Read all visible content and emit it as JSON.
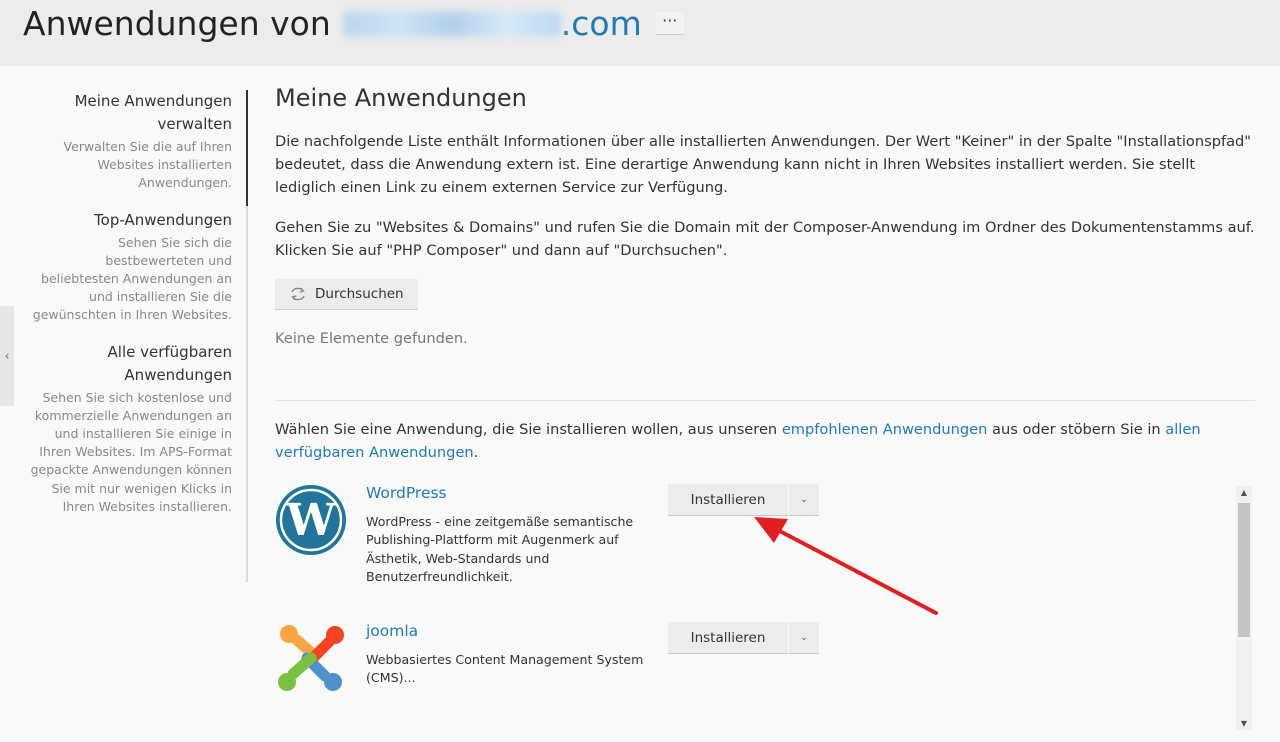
{
  "header": {
    "title_prefix": "Anwendungen von",
    "title_suffix": ".com",
    "more_label": "···"
  },
  "sidebar": {
    "items": [
      {
        "title": "Meine Anwendungen verwalten",
        "desc": "Verwalten Sie die auf Ihren Websites installierten Anwendungen."
      },
      {
        "title": "Top-Anwendungen",
        "desc": "Sehen Sie sich die bestbewerteten und beliebtesten Anwendungen an und installieren Sie die gewünschten in Ihren Websites."
      },
      {
        "title": "Alle verfügbaren Anwendungen",
        "desc": "Sehen Sie sich kostenlose und kommerzielle Anwendungen an und installieren Sie einige in Ihren Websites. Im APS-Format gepackte Anwendungen können Sie mit nur wenigen Klicks in Ihren Websites installieren."
      }
    ]
  },
  "main": {
    "heading": "Meine Anwendungen",
    "para1": "Die nachfolgende Liste enthält Informationen über alle installierten Anwendungen. Der Wert \"Keiner\" in der Spalte \"Installationspfad\" bedeutet, dass die Anwendung extern ist. Eine derartige Anwendung kann nicht in Ihren Websites installiert werden. Sie stellt lediglich einen Link zu einem externen Service zur Verfügung.",
    "para2": "Gehen Sie zu \"Websites & Domains\" und rufen Sie die Domain mit der Composer-Anwendung im Ordner des Dokumentenstamms auf. Klicken Sie auf \"PHP Composer\" und dann auf \"Durchsuchen\".",
    "browse_label": "Durchsuchen",
    "no_items": "Keine Elemente gefunden.",
    "choose_text_1": "Wählen Sie eine Anwendung, die Sie installieren wollen, aus unseren ",
    "choose_link_1": "empfohlenen Anwendungen",
    "choose_text_2": " aus oder stöbern Sie in ",
    "choose_link_2": "allen verfügbaren Anwendungen",
    "choose_text_3": "."
  },
  "apps": [
    {
      "name": "WordPress",
      "desc": "WordPress - eine zeitgemäße semantische Publishing-Plattform mit Augenmerk auf Ästhetik, Web-Standards und Benutzerfreundlichkeit.",
      "install_label": "Installieren",
      "icon": "wordpress-logo"
    },
    {
      "name": "joomla",
      "desc": "Webbasiertes Content Management System (CMS)...",
      "install_label": "Installieren",
      "icon": "joomla-logo"
    }
  ],
  "colors": {
    "link": "#1f7ab8",
    "annotation_arrow": "#e02020"
  }
}
